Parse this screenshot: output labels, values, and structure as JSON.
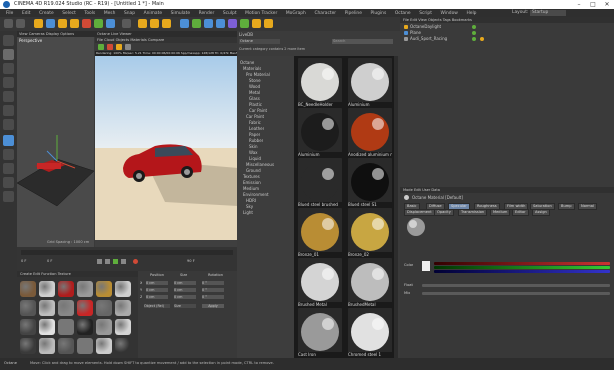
{
  "window": {
    "title": "CINEMA 4D R19.024 Studio (RC - R19) - [Untitled 1 *] - Main",
    "minimize": "–",
    "maximize": "□",
    "close": "✕"
  },
  "menubar": [
    "File",
    "Edit",
    "Create",
    "Select",
    "Tools",
    "Mesh",
    "Snap",
    "Animate",
    "Simulate",
    "Render",
    "Sculpt",
    "Motion Tracker",
    "MoGraph",
    "Character",
    "Pipeline",
    "Plugins",
    "Octane",
    "Script",
    "Window",
    "Help"
  ],
  "layout_label": "Layout:",
  "layout_value": "Startup",
  "viewport1": {
    "title": "Perspective",
    "menu": [
      "View",
      "Cameras",
      "Display",
      "Options",
      "Filter",
      "Panel"
    ]
  },
  "viewport2": {
    "title": "Octane Live Viewer",
    "menu": [
      "File",
      "Cloud",
      "Objects",
      "Materials",
      "Compare"
    ],
    "status": "Rendering: 100%  Ms/sec: 5.21  Time: 00:00:06/00:00:06  Spp/maxspp: 128/128  Tri: 0/47k  Mesh: 5  Hair: 0  GPU: 61  VRAM: 0.99"
  },
  "viewport1_footer": "Grid Spacing : 1000 cm",
  "material_browser": {
    "title": "LiveDB",
    "search_placeholder": "Search",
    "dropdown": "Octane",
    "filter_label": "Current category contains 2 more item",
    "tree": [
      "Octane",
      "Materials",
      "Pro Material",
      "Stone",
      "Wood",
      "Metal",
      "Glass",
      "Plastic",
      "Car Paint",
      "Car Paint",
      "Fabric",
      "Leather",
      "Paper",
      "Rubber",
      "Skin",
      "Wax",
      "Liquid",
      "Miscellaneous",
      "Ground",
      "Textures",
      "Emission",
      "Medium",
      "Environment",
      "HDRI",
      "Sky",
      "Light"
    ],
    "thumbs": [
      {
        "label": "BC_NeedleHolder",
        "color": "#d9d9d6"
      },
      {
        "label": "Aluminium",
        "color": "#cfcfcf"
      },
      {
        "label": "Aluminium",
        "color": "#1c1c1c"
      },
      {
        "label": "Anodized aluminium matte",
        "color": "#b03a14"
      },
      {
        "label": "Blued steel brushed",
        "color": "#2a2a2a"
      },
      {
        "label": "Blued steel S1",
        "color": "#0f0f0f"
      },
      {
        "label": "Bronze_01",
        "color": "#b98d34"
      },
      {
        "label": "Bronze_02",
        "color": "#c8a642"
      },
      {
        "label": "Brushed Metal",
        "color": "#d4d4d4"
      },
      {
        "label": "BrushedMetal",
        "color": "#bdbdbd"
      },
      {
        "label": "Cast Iron",
        "color": "#9a9a9a"
      },
      {
        "label": "Chromed steel 1",
        "color": "#e1e1e1"
      }
    ]
  },
  "object_manager": {
    "menu": [
      "File",
      "Edit",
      "View",
      "Objects",
      "Tags",
      "Bookmarks"
    ],
    "objects": [
      "OctaneDaylight",
      "Plane",
      "Audi_Sport_Racing"
    ]
  },
  "attributes": {
    "menu": [
      "Mode",
      "Edit",
      "User Data"
    ],
    "title": "Octane Material [Default]",
    "tabs": [
      "Basic",
      "Diffuse",
      "Specular",
      "Roughness",
      "Film width",
      "Saturation",
      "Bump",
      "Normal",
      "Displacement",
      "Opacity",
      "Transmission",
      "Medium",
      "Editor",
      "Assign"
    ],
    "color_label": "Color",
    "float_label": "Float",
    "mix_label": "Mix"
  },
  "timeline": {
    "start": "0 F",
    "end": "90 F",
    "frame": "0 F"
  },
  "material_panel": {
    "menu": [
      "Create",
      "Edit",
      "Function",
      "Texture"
    ]
  },
  "coordinates": {
    "headers": [
      "Position",
      "Size",
      "Rotation"
    ],
    "rows": [
      {
        "axis": "X",
        "pos": "0 cm",
        "size": "0 cm",
        "rot": "0 °"
      },
      {
        "axis": "Y",
        "pos": "0 cm",
        "size": "0 cm",
        "rot": "0 °"
      },
      {
        "axis": "Z",
        "pos": "0 cm",
        "size": "0 cm",
        "rot": "0 °"
      }
    ],
    "mode": "Object (Rel)",
    "size_mode": "Size",
    "apply": "Apply"
  },
  "status": "Move: Click and drag to move elements. Hold down SHIFT to quantize movement / add to the selection in point mode, CTRL to remove.",
  "status_left": "Octane"
}
